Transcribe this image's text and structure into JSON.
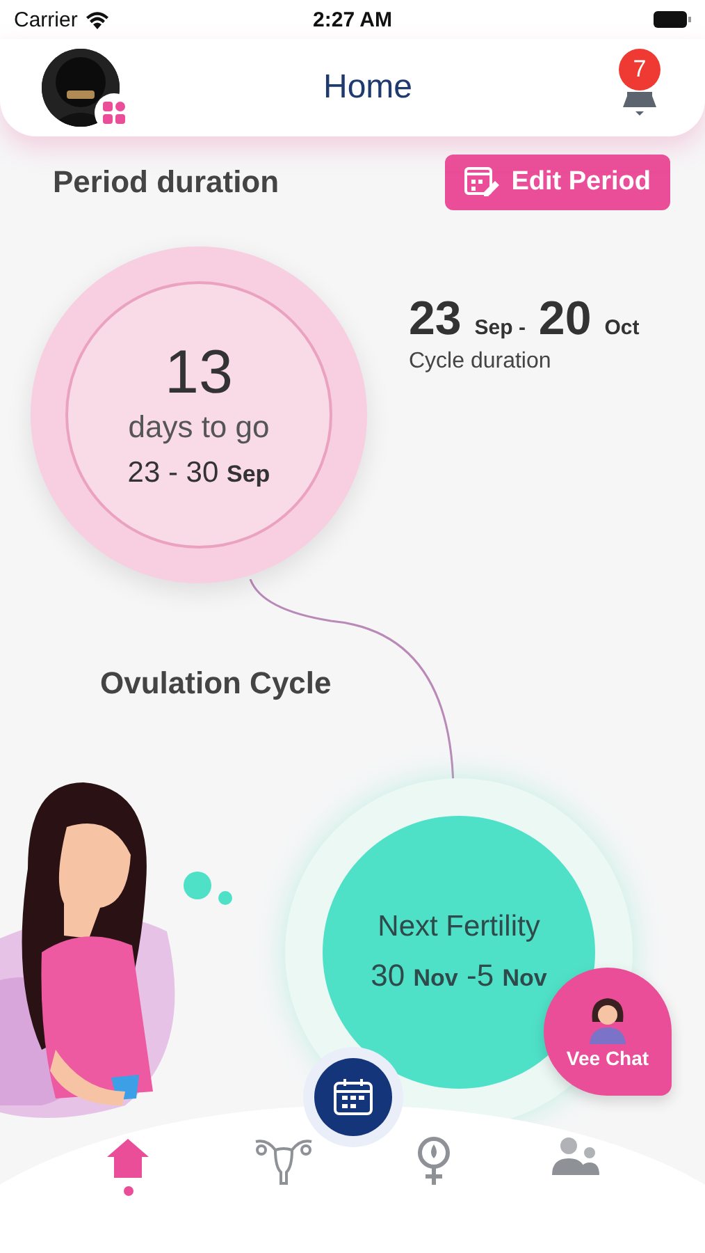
{
  "status_bar": {
    "carrier": "Carrier",
    "time": "2:27 AM"
  },
  "header": {
    "title": "Home",
    "notification_count": "7"
  },
  "period": {
    "title": "Period duration",
    "edit_button": "Edit Period",
    "days": "13",
    "days_label": "days to go",
    "range": "23 - 30",
    "range_month": "Sep"
  },
  "cycle": {
    "start_day": "23",
    "start_month": "Sep -",
    "end_day": "20",
    "end_month": "Oct",
    "label": "Cycle duration"
  },
  "ovulation": {
    "title": "Ovulation Cycle"
  },
  "fertility": {
    "title": "Next Fertility",
    "start_day": "30",
    "start_month": "Nov",
    "end_day": "-5",
    "end_month": "Nov"
  },
  "chat": {
    "label": "Vee Chat"
  },
  "nav": [
    {
      "kind": "home",
      "selected": true
    },
    {
      "kind": "uterus",
      "selected": false
    },
    {
      "kind": "female",
      "selected": false
    },
    {
      "kind": "people",
      "selected": false
    }
  ]
}
